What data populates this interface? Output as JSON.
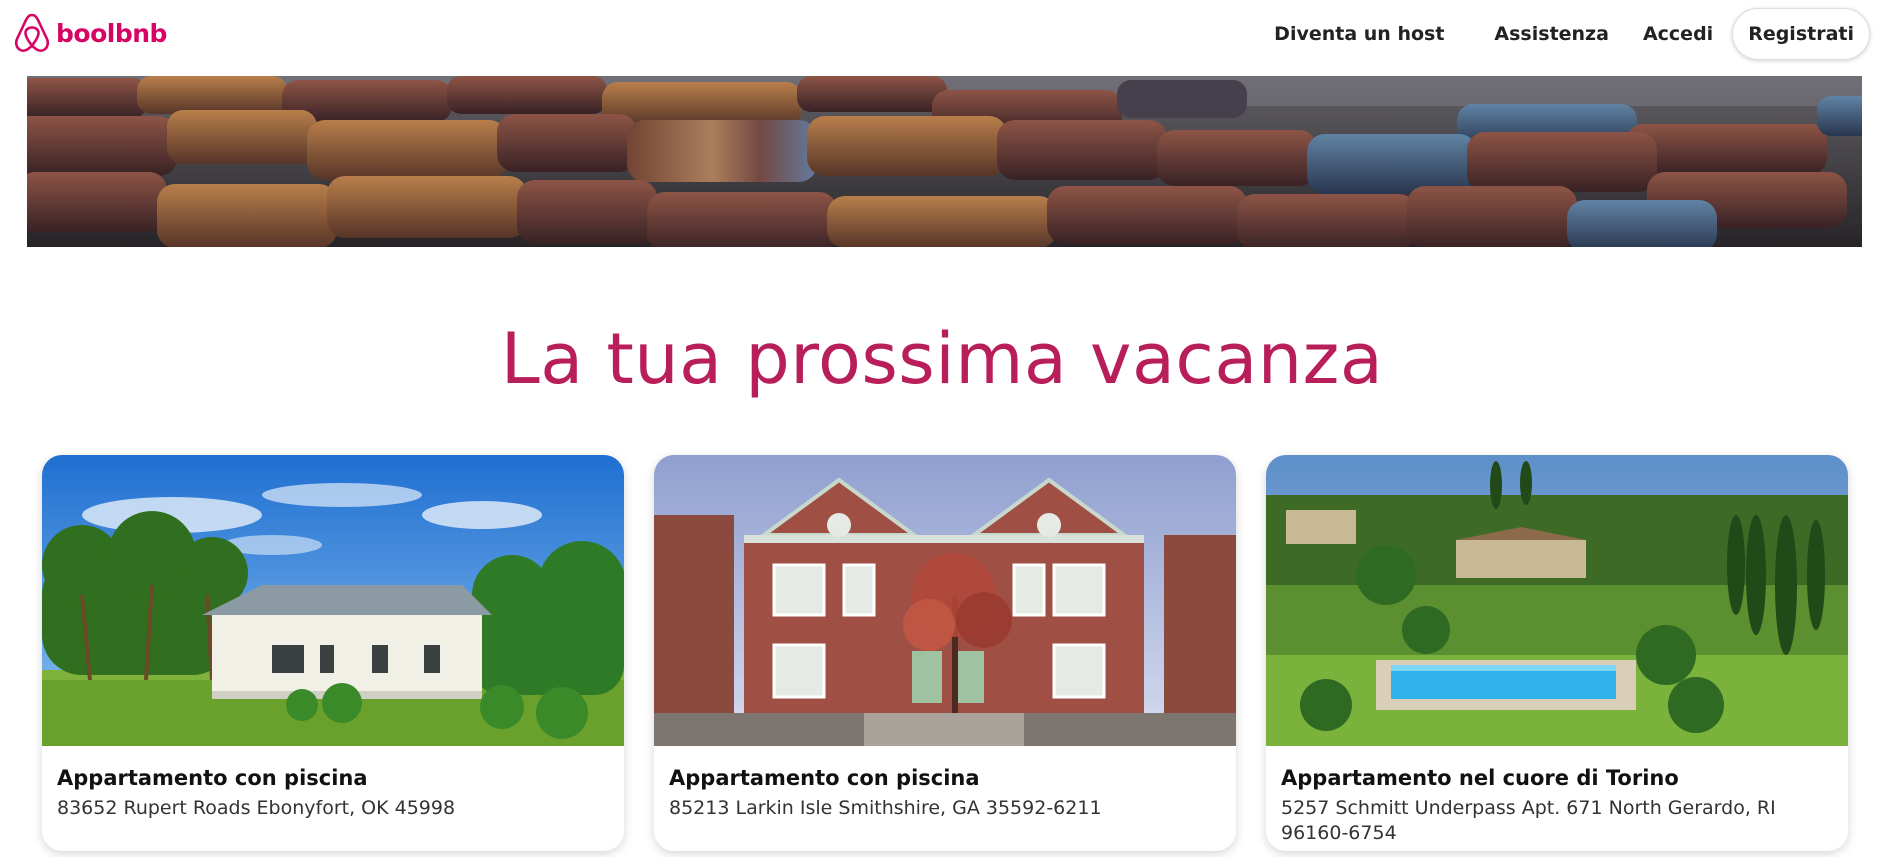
{
  "header": {
    "logo_text": "boolbnb",
    "logo_icon": "airbnb-belo-icon",
    "nav": {
      "become_host": "Diventa un host",
      "help": "Assistenza",
      "login": "Accedi",
      "register": "Registrati"
    }
  },
  "hero": {
    "image": "rock-wall-banner"
  },
  "main": {
    "title": "La tua prossima vacanza",
    "cards": [
      {
        "title": "Appartamento con piscina",
        "address": "83652 Rupert Roads Ebonyfort, OK 45998",
        "image": "tropical-white-house-photo"
      },
      {
        "title": "Appartamento con piscina",
        "address": "85213 Larkin Isle Smithshire, GA 35592-6211",
        "image": "red-brick-house-photo"
      },
      {
        "title": "Appartamento nel cuore di Torino",
        "address": "5257 Schmitt Underpass Apt. 671 North Gerardo, RI 96160-6754",
        "image": "tuscan-villa-pool-photo"
      }
    ]
  },
  "colors": {
    "brand": "#d70466",
    "title": "#b81e5a",
    "text": "#222222"
  }
}
